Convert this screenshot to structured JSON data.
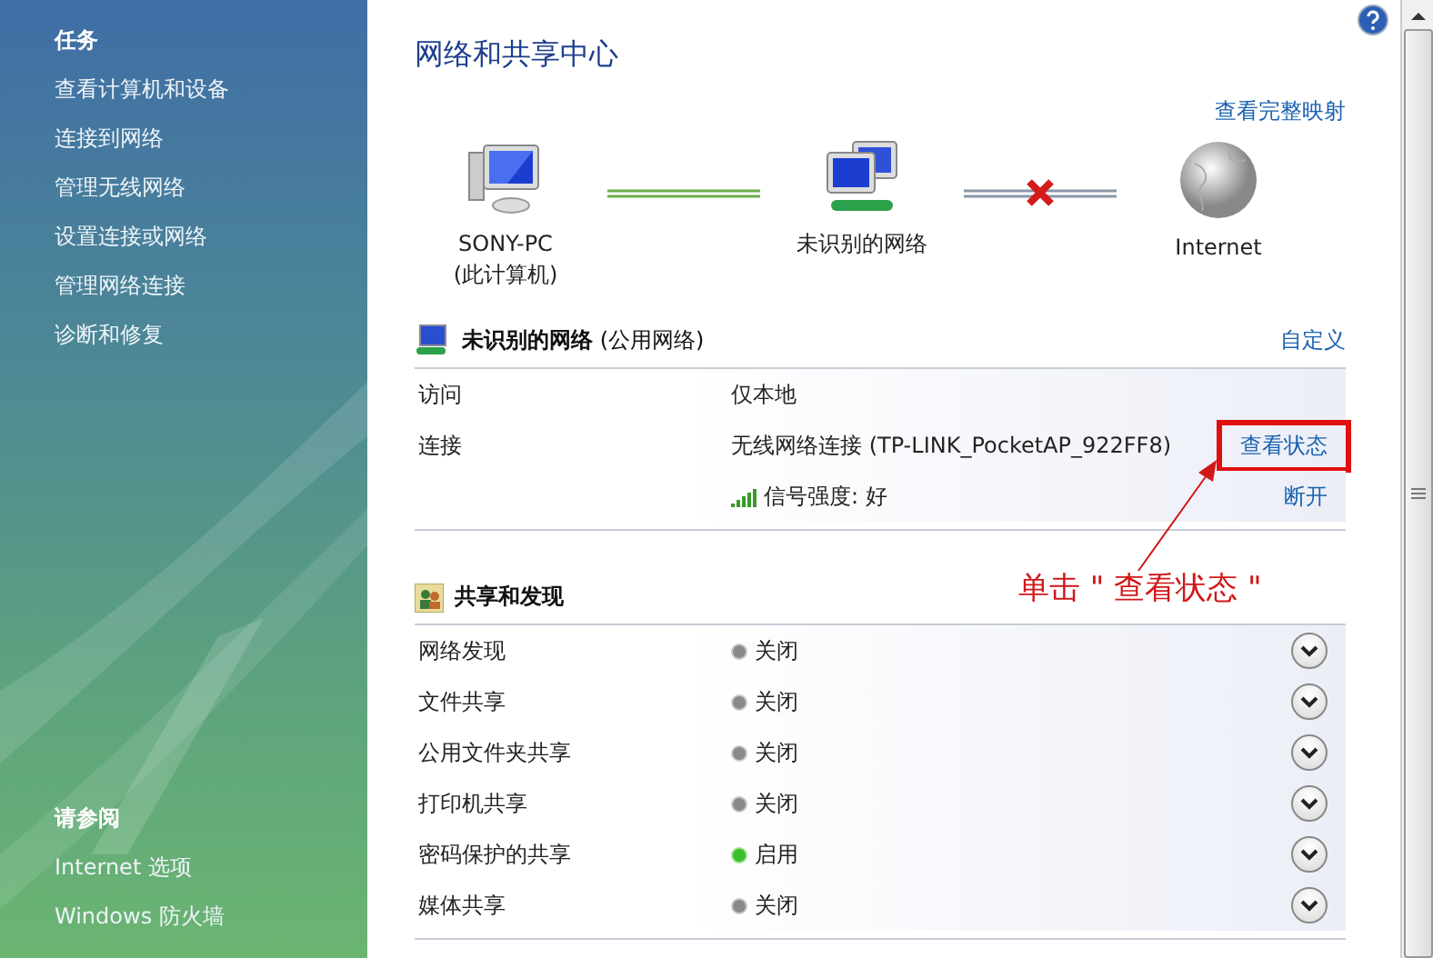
{
  "sidebar": {
    "sections": [
      {
        "heading": "任务",
        "items": [
          "查看计算机和设备",
          "连接到网络",
          "管理无线网络",
          "设置连接或网络",
          "管理网络连接",
          "诊断和修复"
        ]
      },
      {
        "heading": "请参阅",
        "items": [
          "Internet 选项",
          "Windows 防火墙"
        ]
      }
    ]
  },
  "title": "网络和共享中心",
  "full_map_link": "查看完整映射",
  "map": {
    "nodes": [
      {
        "kind": "computer",
        "label": "SONY-PC",
        "sublabel": "(此计算机)"
      },
      {
        "kind": "network",
        "label": "未识别的网络"
      },
      {
        "kind": "internet",
        "label": "Internet"
      }
    ],
    "links": [
      {
        "connected": true
      },
      {
        "connected": false
      }
    ]
  },
  "network": {
    "name": "未识别的网络",
    "type": "(公用网络)",
    "customize_link": "自定义",
    "rows": [
      {
        "label": "访问",
        "value": "仅本地"
      },
      {
        "label": "连接",
        "value": "无线网络连接 (TP-LINK_PocketAP_922FF8)",
        "link": "查看状态",
        "highlighted": true
      },
      {
        "kind": "signal",
        "value": "信号强度: 好",
        "link": "断开",
        "highlighted": false
      }
    ]
  },
  "annotation": {
    "text": "单击 \" 查看状态 \""
  },
  "sharing": {
    "heading": "共享和发现",
    "rows": [
      {
        "label": "网络发现",
        "value": "关闭",
        "on": false
      },
      {
        "label": "文件共享",
        "value": "关闭",
        "on": false
      },
      {
        "label": "公用文件夹共享",
        "value": "关闭",
        "on": false
      },
      {
        "label": "打印机共享",
        "value": "关闭",
        "on": false
      },
      {
        "label": "密码保护的共享",
        "value": "启用",
        "on": true
      },
      {
        "label": "媒体共享",
        "value": "关闭",
        "on": false
      }
    ]
  }
}
